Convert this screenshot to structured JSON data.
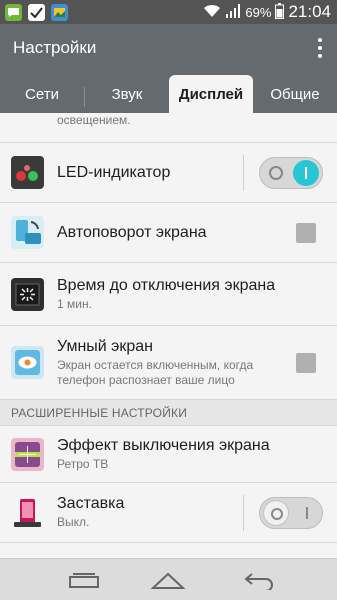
{
  "status_bar": {
    "battery_percent": "69%",
    "time": "21:04",
    "notification_icons": [
      "messaging-icon",
      "checkmark-app-icon",
      "picture-app-icon"
    ],
    "system_icons": [
      "wifi-icon",
      "signal-icon",
      "battery-icon"
    ]
  },
  "header": {
    "title": "Настройки",
    "menu_icon": "more-vert-icon"
  },
  "tabs": [
    {
      "label": "Сети",
      "active": false
    },
    {
      "label": "Звук",
      "active": false
    },
    {
      "label": "Дисплей",
      "active": true
    },
    {
      "label": "Общие",
      "active": false
    }
  ],
  "list": {
    "partial_text": "освещением.",
    "items": [
      {
        "title": "LED-индикатор",
        "subtitle": "",
        "icon": "led-indicator-icon",
        "control": "toggle",
        "state": "on"
      },
      {
        "title": "Автоповорот экрана",
        "subtitle": "",
        "icon": "auto-rotate-icon",
        "control": "checkbox",
        "state": "unchecked"
      },
      {
        "title": "Время до отключения экрана",
        "subtitle": "1 мин.",
        "icon": "screen-timeout-icon",
        "control": "none"
      },
      {
        "title": "Умный экран",
        "subtitle": "Экран остается включенным, когда телефон распознает ваше лицо",
        "icon": "smart-screen-icon",
        "control": "checkbox",
        "state": "unchecked"
      }
    ],
    "section_header": "РАСШИРЕННЫЕ НАСТРОЙКИ",
    "advanced_items": [
      {
        "title": "Эффект выключения экрана",
        "subtitle": "Ретро ТВ",
        "icon": "screen-off-effect-icon",
        "control": "none"
      },
      {
        "title": "Заставка",
        "subtitle": "Выкл.",
        "icon": "daydream-icon",
        "control": "toggle",
        "state": "off"
      }
    ]
  },
  "nav_bar": {
    "buttons": [
      "recent-apps-icon",
      "home-icon",
      "back-icon"
    ]
  },
  "colors": {
    "accent": "#27c6d2",
    "header_bg": "#656a6e",
    "status_bg": "#545454"
  }
}
